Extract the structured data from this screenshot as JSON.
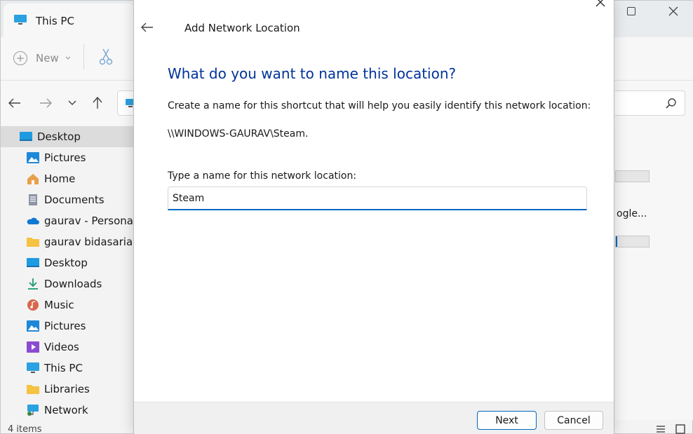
{
  "explorer": {
    "tab_title": "This PC",
    "toolbar": {
      "new_label": "New"
    },
    "sidebar": {
      "items": [
        {
          "label": "Desktop",
          "icon": "desktop-icon",
          "active": true
        },
        {
          "label": "Pictures",
          "icon": "pictures-icon"
        },
        {
          "label": "Home",
          "icon": "home-icon"
        },
        {
          "label": "Documents",
          "icon": "documents-icon"
        },
        {
          "label": "gaurav - Personal",
          "icon": "onedrive-icon"
        },
        {
          "label": "gaurav bidasaria",
          "icon": "folder-icon"
        },
        {
          "label": "Desktop",
          "icon": "desktop-icon"
        },
        {
          "label": "Downloads",
          "icon": "downloads-icon"
        },
        {
          "label": "Music",
          "icon": "music-icon"
        },
        {
          "label": "Pictures",
          "icon": "pictures-icon"
        },
        {
          "label": "Videos",
          "icon": "videos-icon"
        },
        {
          "label": "This PC",
          "icon": "this-pc-icon"
        },
        {
          "label": "Libraries",
          "icon": "libraries-icon"
        },
        {
          "label": "Network",
          "icon": "network-icon"
        }
      ]
    },
    "status": "4 items",
    "right_fragment": "ogle..."
  },
  "dialog": {
    "title": "Add Network Location",
    "heading": "What do you want to name this location?",
    "description": "Create a name for this shortcut that will help you easily identify this network location:",
    "path": "\\\\WINDOWS-GAURAV\\Steam.",
    "name_label": "Type a name for this network location:",
    "name_value": "Steam",
    "next_label": "Next",
    "cancel_label": "Cancel"
  },
  "colors": {
    "accent": "#0067c0",
    "heading": "#003399"
  }
}
